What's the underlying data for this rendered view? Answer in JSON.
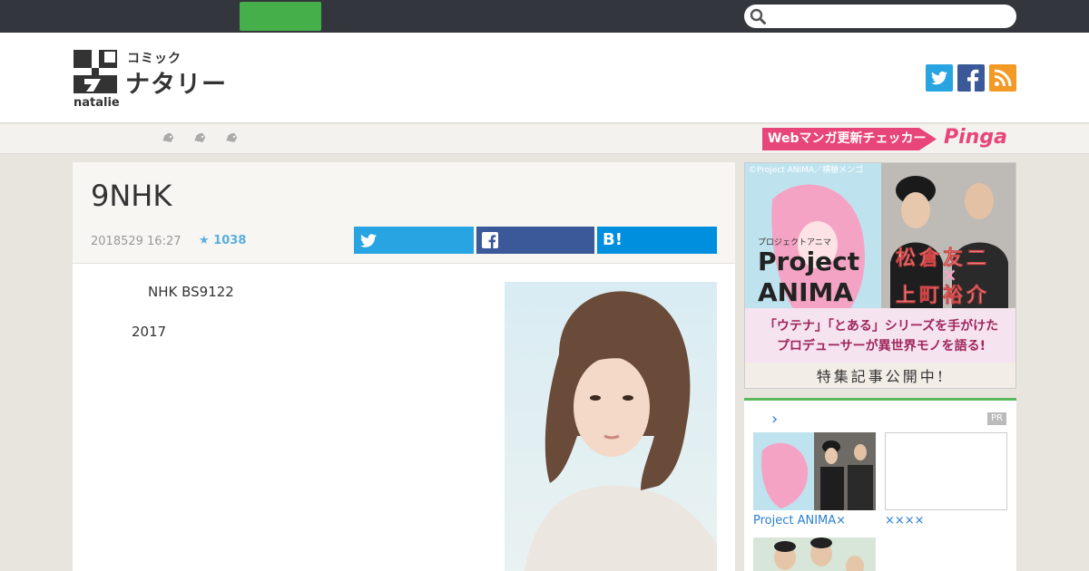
{
  "search": {
    "placeholder": "",
    "icon": "search-icon"
  },
  "logo": {
    "comic_label": "コミック",
    "natalie_jp": "ナタリー",
    "natalie_en": "natalie"
  },
  "social": {
    "twitter_icon": "twitter-icon",
    "facebook_icon": "facebook-icon",
    "rss_icon": "rss-icon"
  },
  "nav": {
    "pinga_label": "Webマンガ更新チェッカー",
    "pinga_logo": "Pinga"
  },
  "article": {
    "title": "9NHK",
    "date": "2018529 16:27",
    "star_count": "1038",
    "share_hatena": "B!",
    "body_line1": "NHK BS9122",
    "body_line2": "2017"
  },
  "ad": {
    "copyright": "©Project ANIMA／横槍メンゴ",
    "kicker": "プロジェクトアニマ",
    "title_line1": "Project",
    "title_line2": "ANIMA",
    "name1": "松倉友二",
    "cross": "×",
    "name2": "上町裕介",
    "lead_line1": "「ウテナ」「とある」シリーズを手がけた",
    "lead_line2": "プロデューサーが異世界モノを語る!",
    "footer": "特集記事公開中!"
  },
  "pr": {
    "chevron": "›",
    "badge": "PR",
    "caption1": "Project ANIMA×",
    "caption2": "××××"
  },
  "colors": {
    "topbar": "#33363c",
    "green": "#45b04a",
    "twitter": "#27a4e1",
    "facebook": "#3b5998",
    "hatena": "#008fde",
    "rss": "#f39a26",
    "pinga": "#e8457a"
  }
}
